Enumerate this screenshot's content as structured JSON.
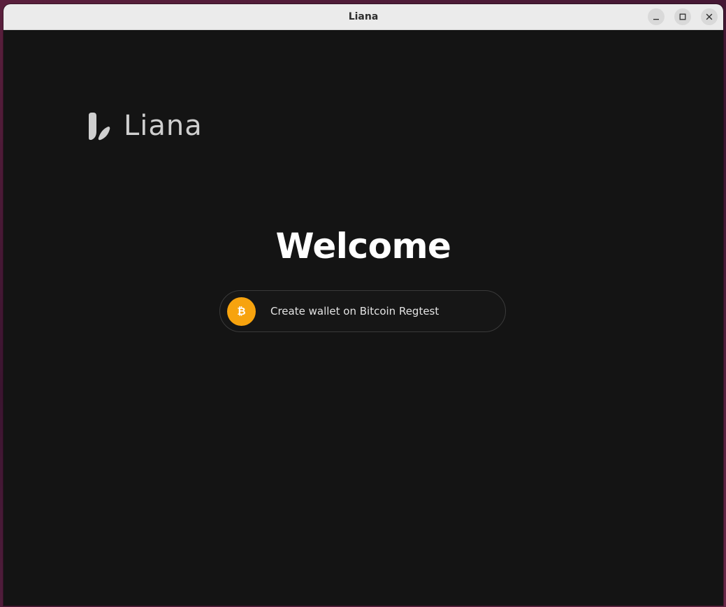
{
  "window": {
    "title": "Liana",
    "controls": {
      "minimize_icon": "minimize-icon",
      "maximize_icon": "maximize-icon",
      "close_icon": "close-icon"
    }
  },
  "logo": {
    "text": "Liana",
    "mark_icon": "liana-logo-mark"
  },
  "main": {
    "heading": "Welcome",
    "create_button": {
      "label": "Create wallet on Bitcoin Regtest",
      "icon": "bitcoin-icon",
      "icon_glyph": "₿"
    }
  },
  "colors": {
    "background": "#141414",
    "bitcoin_accent": "#f7a30e",
    "heading": "#ffffff",
    "logo": "#cfcfcf"
  }
}
